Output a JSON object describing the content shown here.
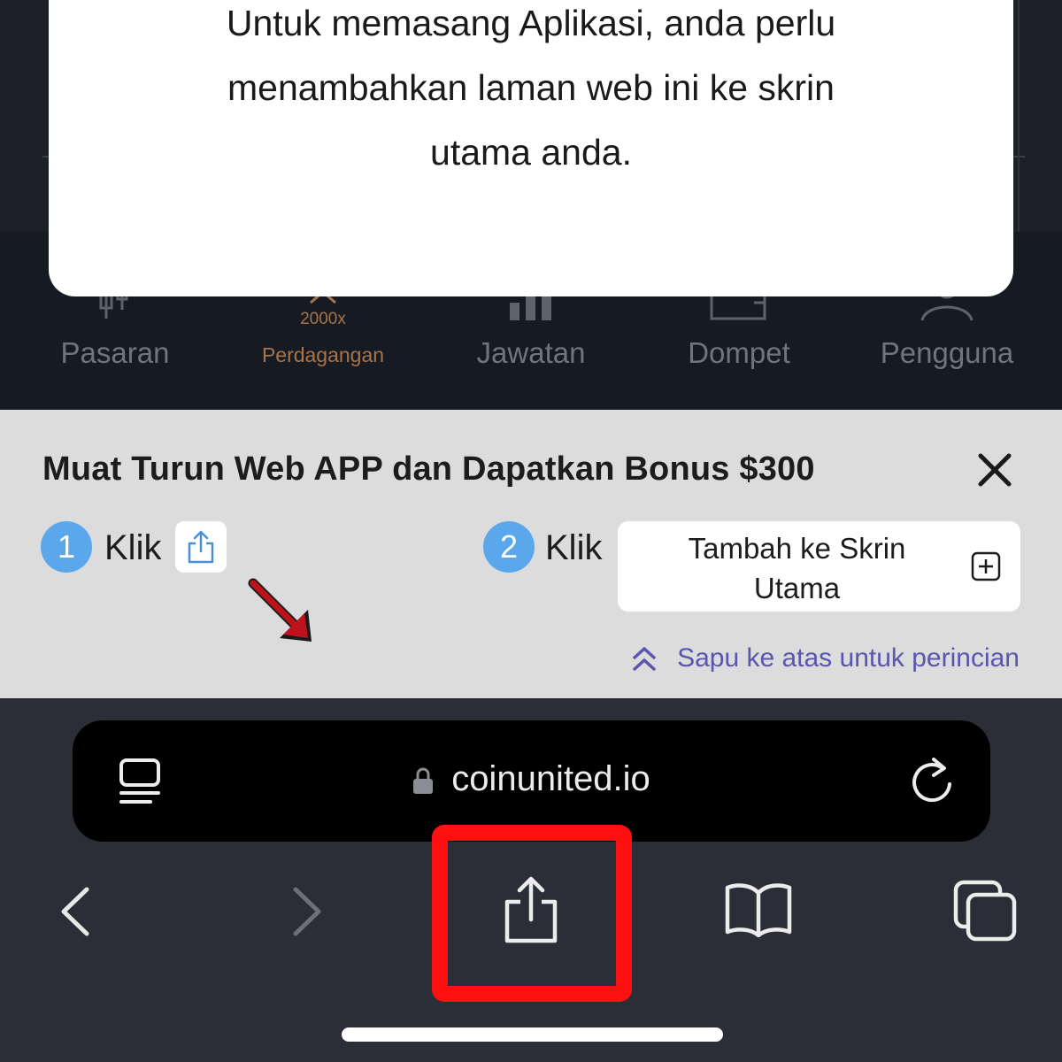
{
  "modal": {
    "text": "Untuk memasang Aplikasi, anda perlu menambahkan laman web ini ke skrin utama anda."
  },
  "tabs": [
    {
      "label": "Pasaran",
      "icon": "candlestick-icon",
      "active": false
    },
    {
      "label": "Perdagangan",
      "sub": "2000x",
      "icon": "trade-icon",
      "active": true
    },
    {
      "label": "Jawatan",
      "icon": "bar-chart-icon",
      "active": false
    },
    {
      "label": "Dompet",
      "icon": "wallet-icon",
      "active": false
    },
    {
      "label": "Pengguna",
      "icon": "user-icon",
      "active": false
    }
  ],
  "banner": {
    "title": "Muat Turun Web APP dan Dapatkan Bonus $300",
    "step1": {
      "num": "1",
      "word": "Klik"
    },
    "step2": {
      "num": "2",
      "word": "Klik"
    },
    "add_home_label": "Tambah ke Skrin Utama",
    "swipe_hint": "Sapu ke atas untuk perincian"
  },
  "browser": {
    "domain": "coinunited.io"
  },
  "colors": {
    "accent_blue": "#5aa7ec",
    "highlight_red": "#ff1010",
    "active_tab": "#a8744a",
    "swipe_hint": "#5a55b0"
  }
}
